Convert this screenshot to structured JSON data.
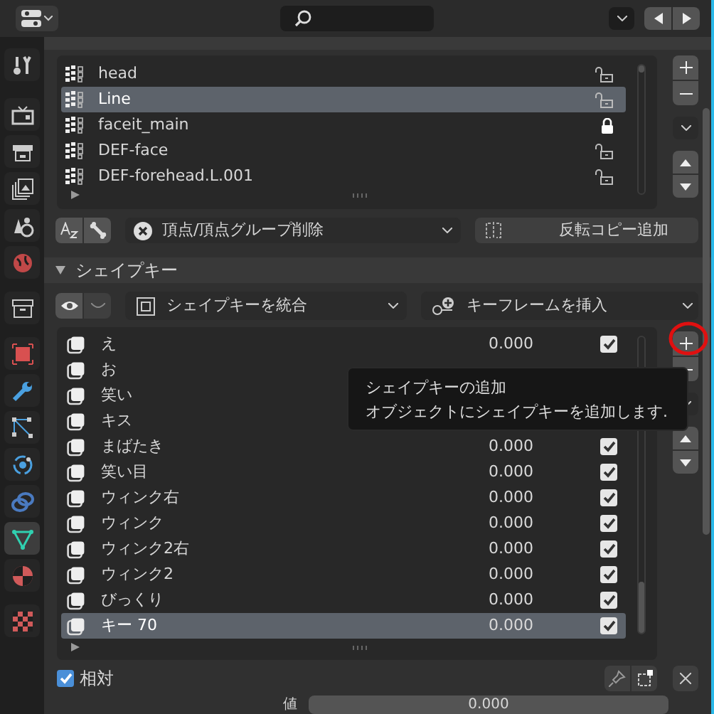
{
  "sidebar": {
    "tabs": [
      {
        "kind": "tool",
        "selected": false
      },
      {
        "kind": "render",
        "selected": false
      },
      {
        "kind": "output",
        "selected": false
      },
      {
        "kind": "view_layer",
        "selected": false
      },
      {
        "kind": "scene",
        "selected": false
      },
      {
        "kind": "world",
        "selected": false
      },
      {
        "kind": "collection",
        "selected": false
      },
      {
        "kind": "object",
        "selected": false
      },
      {
        "kind": "modifiers",
        "selected": false
      },
      {
        "kind": "particles",
        "selected": false
      },
      {
        "kind": "physics",
        "selected": false
      },
      {
        "kind": "constraints",
        "selected": false
      },
      {
        "kind": "data",
        "selected": true
      },
      {
        "kind": "material",
        "selected": false
      },
      {
        "kind": "texture",
        "selected": false
      }
    ]
  },
  "vertex_groups": {
    "items": [
      {
        "name": "head",
        "locked": false,
        "selected": false
      },
      {
        "name": "Line",
        "locked": false,
        "selected": true
      },
      {
        "name": "faceit_main",
        "locked": true,
        "selected": false
      },
      {
        "name": "DEF-face",
        "locked": false,
        "selected": false
      },
      {
        "name": "DEF-forehead.L.001",
        "locked": false,
        "selected": false
      }
    ],
    "remove_menu": "頂点/頂点グループ削除",
    "mirror_button": "反転コピー追加"
  },
  "shape_keys": {
    "title": "シェイプキー",
    "expanded": true,
    "merge_menu": "シェイプキーを統合",
    "keyframe_menu": "キーフレームを挿入",
    "items": [
      {
        "name": "え",
        "value": "0.000",
        "checked": true,
        "selected": false
      },
      {
        "name": "お",
        "selected": false
      },
      {
        "name": "笑い",
        "selected": false
      },
      {
        "name": "キス",
        "selected": false
      },
      {
        "name": "まばたき",
        "value": "0.000",
        "checked": true,
        "selected": false
      },
      {
        "name": "笑い目",
        "value": "0.000",
        "checked": true,
        "selected": false
      },
      {
        "name": "ウィンク右",
        "value": "0.000",
        "checked": true,
        "selected": false
      },
      {
        "name": "ウィンク",
        "value": "0.000",
        "checked": true,
        "selected": false
      },
      {
        "name": "ウィンク2右",
        "value": "0.000",
        "checked": true,
        "selected": false
      },
      {
        "name": "ウィンク2",
        "value": "0.000",
        "checked": true,
        "selected": false
      },
      {
        "name": "びっくり",
        "value": "0.000",
        "checked": true,
        "selected": false
      },
      {
        "name": "キー 70",
        "value": "0.000",
        "checked": true,
        "selected": true
      }
    ],
    "relative": {
      "label": "相対",
      "checked": true
    },
    "value_field": {
      "label": "値",
      "value": "0.000"
    }
  },
  "tooltip": {
    "title": "シェイプキーの追加",
    "description": "オブジェクトにシェイプキーを追加します."
  }
}
